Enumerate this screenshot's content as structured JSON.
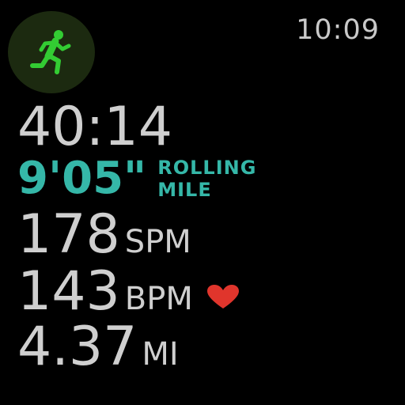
{
  "header": {
    "time": "10:09",
    "workout_icon": "running-figure-icon"
  },
  "metrics": {
    "elapsed_time": "40:14",
    "rolling_pace": {
      "value": "9'05\"",
      "label_line1": "ROLLING",
      "label_line2": "MILE"
    },
    "cadence": {
      "value": "178",
      "unit": "SPM"
    },
    "heart_rate": {
      "value": "143",
      "unit": "BPM",
      "icon": "heart-icon"
    },
    "distance": {
      "value": "4.37",
      "unit": "MI"
    }
  },
  "colors": {
    "accent_green": "#33cc33",
    "pace_teal": "#35b7a8",
    "text_gray": "#cfcfcf",
    "heart_red": "#e0352c",
    "background": "#000000"
  }
}
